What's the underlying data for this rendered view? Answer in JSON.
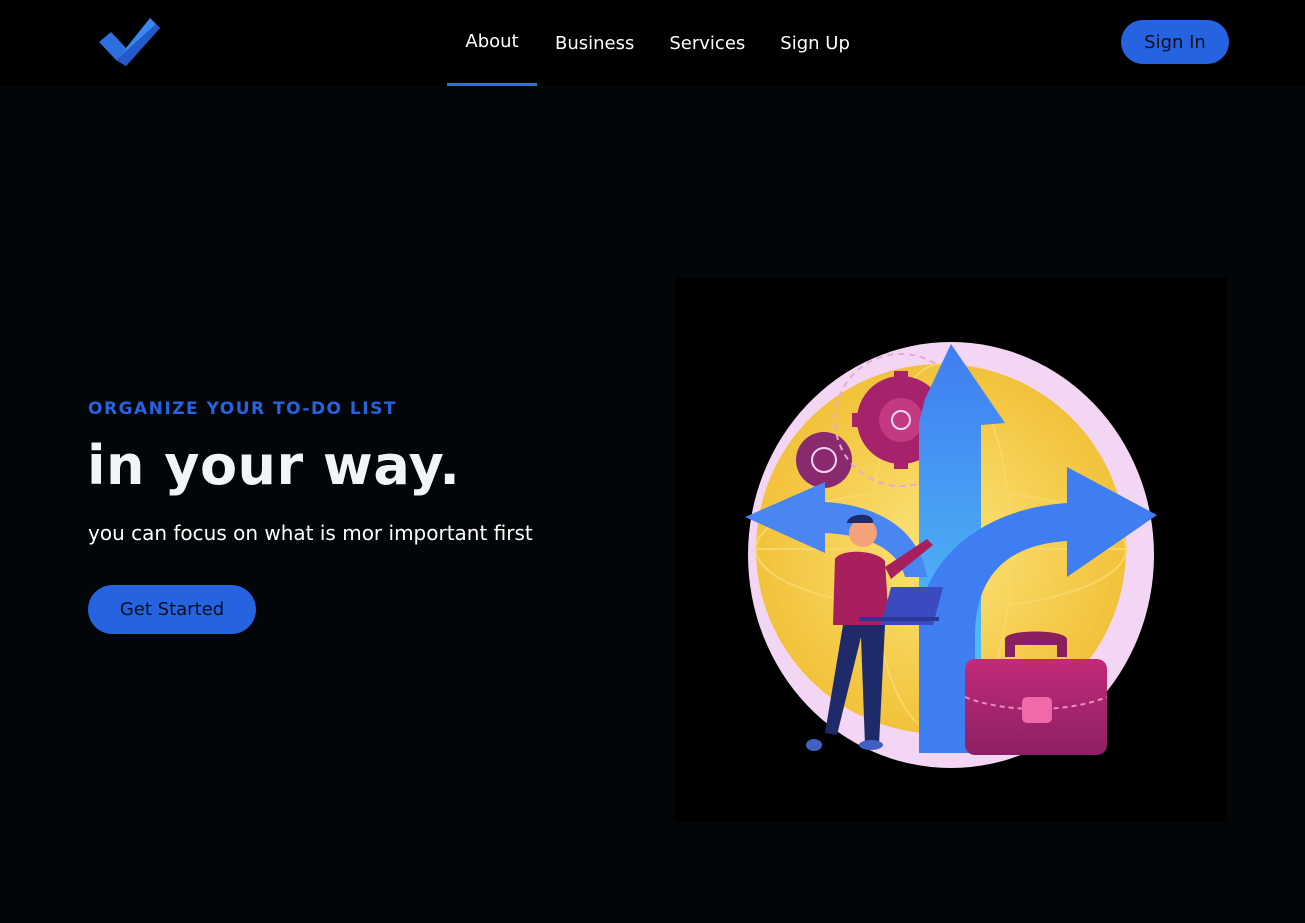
{
  "nav": {
    "logo_icon": "checkmark-logo-icon",
    "links": [
      {
        "label": "About",
        "active": true
      },
      {
        "label": "Business"
      },
      {
        "label": "Services"
      },
      {
        "label": "Sign Up"
      }
    ],
    "signin_label": "Sign In"
  },
  "hero": {
    "kicker": "ORGANIZE YOUR TO-DO LIST",
    "title": "in your way.",
    "subtitle": "you can focus on what is mor important first",
    "cta_label": "Get Started"
  },
  "illustration": {
    "icon": "person-with-laptop-at-crossroads-illustration"
  },
  "colors": {
    "accent": "#2563e0",
    "nav_bg": "#000000",
    "page_bg": "#030609"
  }
}
